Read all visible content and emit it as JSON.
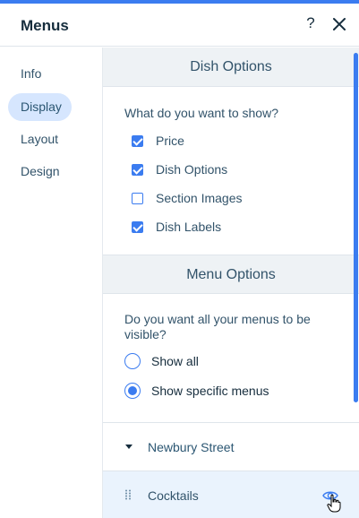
{
  "header": {
    "title": "Menus",
    "help_label": "?"
  },
  "sidebar": {
    "items": [
      {
        "label": "Info",
        "active": false
      },
      {
        "label": "Display",
        "active": true
      },
      {
        "label": "Layout",
        "active": false
      },
      {
        "label": "Design",
        "active": false
      }
    ]
  },
  "dish_options": {
    "title": "Dish Options",
    "question": "What do you want to show?",
    "options": [
      {
        "label": "Price",
        "checked": true
      },
      {
        "label": "Dish Options",
        "checked": true
      },
      {
        "label": "Section Images",
        "checked": false
      },
      {
        "label": "Dish Labels",
        "checked": true
      }
    ]
  },
  "menu_options": {
    "title": "Menu Options",
    "question": "Do you want all your menus to be visible?",
    "choices": [
      {
        "label": "Show all",
        "selected": false
      },
      {
        "label": "Show specific menus",
        "selected": true
      }
    ]
  },
  "menus_list": {
    "group": "Newbury Street",
    "items": [
      {
        "label": "Cocktails",
        "visible": true
      }
    ]
  },
  "colors": {
    "accent": "#3b7cf0",
    "selected_nav_bg": "#d6e6fe",
    "section_header_bg": "#eef2f5",
    "item_row_bg": "#eaf3fd"
  }
}
